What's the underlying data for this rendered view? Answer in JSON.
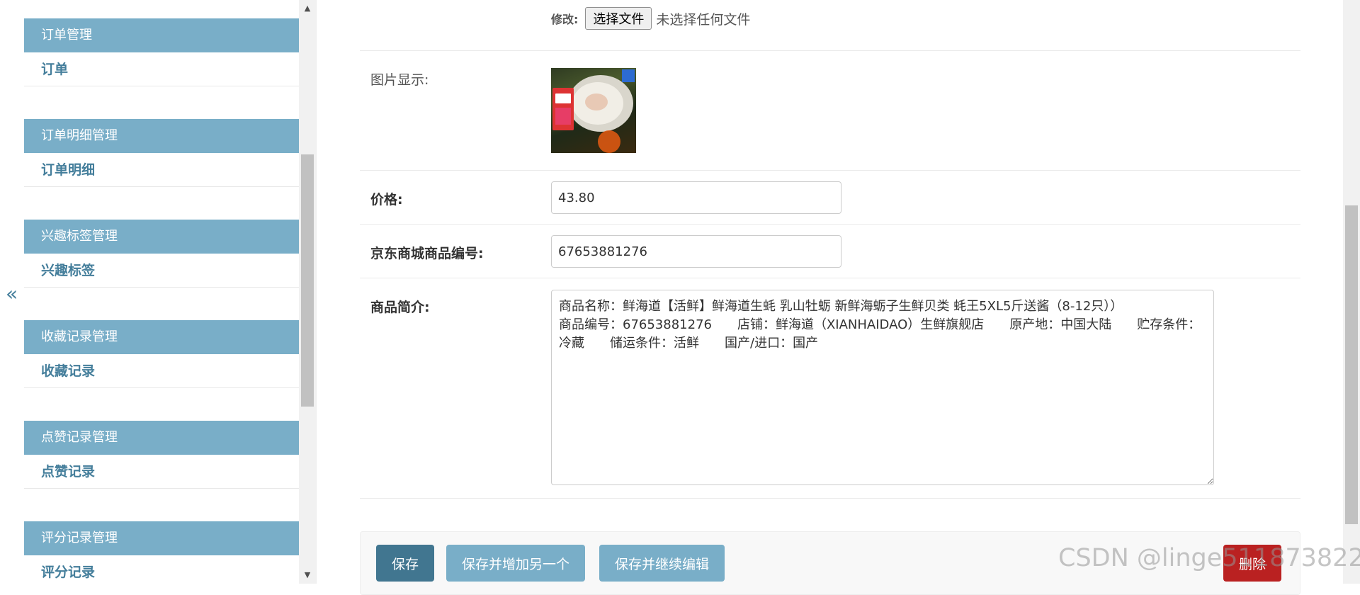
{
  "sidebar": {
    "collapse_icon": "«",
    "modules": [
      {
        "caption": "订单管理",
        "item": "订单"
      },
      {
        "caption": "订单明细管理",
        "item": "订单明细"
      },
      {
        "caption": "兴趣标签管理",
        "item": "兴趣标签"
      },
      {
        "caption": "收藏记录管理",
        "item": "收藏记录"
      },
      {
        "caption": "点赞记录管理",
        "item": "点赞记录"
      },
      {
        "caption": "评分记录管理",
        "item": "评分记录"
      }
    ]
  },
  "form": {
    "image_field": {
      "modify_label": "修改:",
      "choose_file_button": "选择文件",
      "no_file_text": "未选择任何文件",
      "preview_label": "图片显示:"
    },
    "price": {
      "label": "价格:",
      "value": "43.80"
    },
    "jd_sku": {
      "label": "京东商城商品编号:",
      "value": "67653881276"
    },
    "intro": {
      "label": "商品简介:",
      "value": "商品名称：鲜海道【活鲜】鲜海道生蚝 乳山牡蛎 新鲜海蛎子生鲜贝类 蚝王5XL5斤送酱（8-12只））\n商品编号：67653881276　　店铺：鲜海道（XIANHAIDAO）生鲜旗舰店　　原产地：中国大陆　　贮存条件：冷藏　　储运条件：活鲜　　国产/进口：国产"
    }
  },
  "actions": {
    "save": "保存",
    "save_add_another": "保存并增加另一个",
    "save_continue": "保存并继续编辑",
    "delete": "删除"
  },
  "watermark": "CSDN @linge511873822",
  "colors": {
    "sidebar_caption_bg": "#79aec8",
    "link": "#447e9b",
    "primary_button": "#417690",
    "secondary_button": "#79aec8",
    "delete_button": "#ba2121"
  }
}
